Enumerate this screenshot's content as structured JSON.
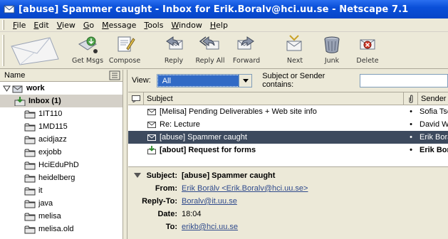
{
  "window": {
    "title": "[abuse] Spammer caught - Inbox for Erik.Boralv@hci.uu.se - Netscape 7.1"
  },
  "menu": [
    {
      "u": "F",
      "rest": "ile"
    },
    {
      "u": "E",
      "rest": "dit"
    },
    {
      "u": "V",
      "rest": "iew"
    },
    {
      "u": "G",
      "rest": "o"
    },
    {
      "u": "M",
      "rest": "essage"
    },
    {
      "u": "T",
      "rest": "ools"
    },
    {
      "u": "W",
      "rest": "indow"
    },
    {
      "u": "H",
      "rest": "elp"
    }
  ],
  "toolbar": {
    "get_msgs": "Get Msgs",
    "compose": "Compose",
    "reply": "Reply",
    "reply_all": "Reply All",
    "forward": "Forward",
    "next": "Next",
    "junk": "Junk",
    "delete": "Delete"
  },
  "folders": {
    "header": "Name",
    "account": "work",
    "inbox": "Inbox (1)",
    "items": [
      "1IT110",
      "1MD115",
      "acidjazz",
      "exjobb",
      "HciEduPhD",
      "heidelberg",
      "it",
      "java",
      "melisa",
      "melisa.old"
    ]
  },
  "viewbar": {
    "view_label": "View:",
    "view_value": "All",
    "search_label": "Subject or Sender contains:",
    "search_value": ""
  },
  "columns": {
    "subject": "Subject",
    "sender": "Sender"
  },
  "messages": [
    {
      "subject": "[Melisa] Pending Deliverables + Web site info",
      "dot": "•",
      "sender": "Sofia Tse"
    },
    {
      "subject": "Re: Lecture",
      "dot": "•",
      "sender": "David We"
    },
    {
      "subject": "[abuse] Spammer caught",
      "dot": "•",
      "sender": "Erik Borä"
    },
    {
      "subject": "[about] Request for forms",
      "dot": "•",
      "sender": "Erik Borä"
    }
  ],
  "preview": {
    "subject_label": "Subject:",
    "subject": "[abuse] Spammer caught",
    "from_label": "From:",
    "from": "Erik Borälv <Erik.Boralv@hci.uu.se>",
    "replyto_label": "Reply-To:",
    "replyto": "Boralv@it.uu.se",
    "date_label": "Date:",
    "date": "18:04",
    "to_label": "To:",
    "to": "erikb@hci.uu.se"
  }
}
